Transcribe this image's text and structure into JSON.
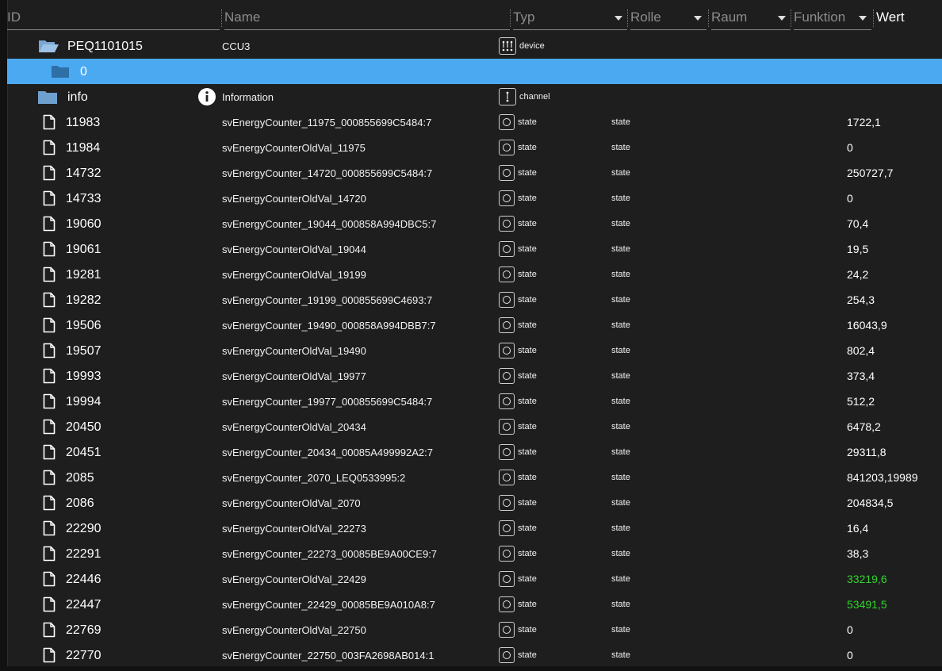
{
  "header": {
    "col_id": "ID",
    "col_name": "Name",
    "col_typ": "Typ",
    "col_rolle": "Rolle",
    "col_raum": "Raum",
    "col_funktion": "Funktion",
    "col_wert": "Wert"
  },
  "tree": {
    "device": {
      "id": "PEQ1101015",
      "name": "CCU3",
      "type": "device",
      "icon": "folder-open-icon"
    },
    "channel0": {
      "id": "0",
      "icon": "folder-icon",
      "selected": true
    },
    "info": {
      "id": "info",
      "name": "Information",
      "type": "channel",
      "icon": "folder-icon",
      "name_icon": "info-icon"
    }
  },
  "colors": {
    "selected_row": "#4ba9f2",
    "changed_value": "#32d52e",
    "background": "#1e1e1e"
  },
  "states": [
    {
      "id": "11983",
      "name": "svEnergyCounter_11975_000855699C5484:7",
      "type": "state",
      "role": "state",
      "value": "1722,1",
      "changed": false
    },
    {
      "id": "11984",
      "name": "svEnergyCounterOldVal_11975",
      "type": "state",
      "role": "state",
      "value": "0",
      "changed": false
    },
    {
      "id": "14732",
      "name": "svEnergyCounter_14720_000855699C5484:7",
      "type": "state",
      "role": "state",
      "value": "250727,7",
      "changed": false
    },
    {
      "id": "14733",
      "name": "svEnergyCounterOldVal_14720",
      "type": "state",
      "role": "state",
      "value": "0",
      "changed": false
    },
    {
      "id": "19060",
      "name": "svEnergyCounter_19044_000858A994DBC5:7",
      "type": "state",
      "role": "state",
      "value": "70,4",
      "changed": false
    },
    {
      "id": "19061",
      "name": "svEnergyCounterOldVal_19044",
      "type": "state",
      "role": "state",
      "value": "19,5",
      "changed": false
    },
    {
      "id": "19281",
      "name": "svEnergyCounterOldVal_19199",
      "type": "state",
      "role": "state",
      "value": "24,2",
      "changed": false
    },
    {
      "id": "19282",
      "name": "svEnergyCounter_19199_000855699C4693:7",
      "type": "state",
      "role": "state",
      "value": "254,3",
      "changed": false
    },
    {
      "id": "19506",
      "name": "svEnergyCounter_19490_000858A994DBB7:7",
      "type": "state",
      "role": "state",
      "value": "16043,9",
      "changed": false
    },
    {
      "id": "19507",
      "name": "svEnergyCounterOldVal_19490",
      "type": "state",
      "role": "state",
      "value": "802,4",
      "changed": false
    },
    {
      "id": "19993",
      "name": "svEnergyCounterOldVal_19977",
      "type": "state",
      "role": "state",
      "value": "373,4",
      "changed": false
    },
    {
      "id": "19994",
      "name": "svEnergyCounter_19977_000855699C5484:7",
      "type": "state",
      "role": "state",
      "value": "512,2",
      "changed": false
    },
    {
      "id": "20450",
      "name": "svEnergyCounterOldVal_20434",
      "type": "state",
      "role": "state",
      "value": "6478,2",
      "changed": false
    },
    {
      "id": "20451",
      "name": "svEnergyCounter_20434_00085A499992A2:7",
      "type": "state",
      "role": "state",
      "value": "29311,8",
      "changed": false
    },
    {
      "id": "2085",
      "name": "svEnergyCounter_2070_LEQ0533995:2",
      "type": "state",
      "role": "state",
      "value": "841203,19989",
      "changed": false
    },
    {
      "id": "2086",
      "name": "svEnergyCounterOldVal_2070",
      "type": "state",
      "role": "state",
      "value": "204834,5",
      "changed": false
    },
    {
      "id": "22290",
      "name": "svEnergyCounterOldVal_22273",
      "type": "state",
      "role": "state",
      "value": "16,4",
      "changed": false
    },
    {
      "id": "22291",
      "name": "svEnergyCounter_22273_00085BE9A00CE9:7",
      "type": "state",
      "role": "state",
      "value": "38,3",
      "changed": false
    },
    {
      "id": "22446",
      "name": "svEnergyCounterOldVal_22429",
      "type": "state",
      "role": "state",
      "value": "33219,6",
      "changed": true
    },
    {
      "id": "22447",
      "name": "svEnergyCounter_22429_00085BE9A010A8:7",
      "type": "state",
      "role": "state",
      "value": "53491,5",
      "changed": true
    },
    {
      "id": "22769",
      "name": "svEnergyCounterOldVal_22750",
      "type": "state",
      "role": "state",
      "value": "0",
      "changed": false
    },
    {
      "id": "22770",
      "name": "svEnergyCounter_22750_003FA2698AB014:1",
      "type": "state",
      "role": "state",
      "value": "0",
      "changed": false
    }
  ]
}
